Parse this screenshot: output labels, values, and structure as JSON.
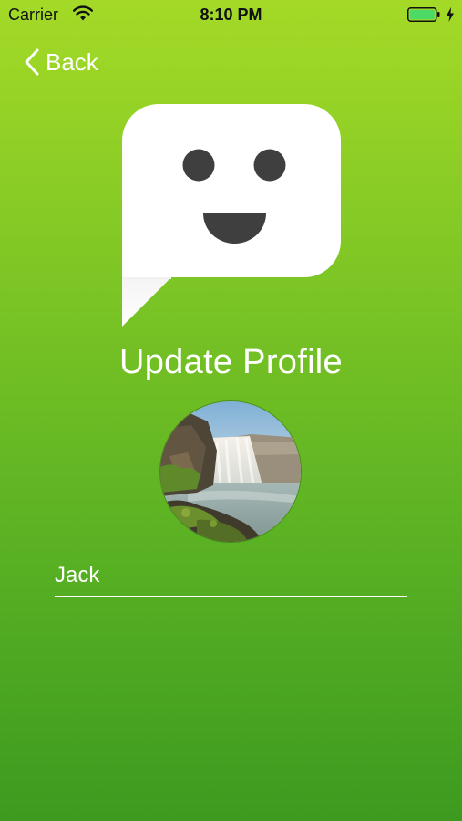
{
  "status_bar": {
    "carrier": "Carrier",
    "time": "8:10 PM",
    "wifi_icon": "wifi-icon",
    "battery_icon": "battery-icon",
    "battery_level": 1.0,
    "charging_icon": "bolt-icon"
  },
  "nav": {
    "back_label": "Back",
    "back_icon": "chevron-left-icon"
  },
  "logo": {
    "icon": "smiley-speech-bubble-icon"
  },
  "title": "Update Profile",
  "avatar": {
    "image": "waterfall-photo"
  },
  "name_field": {
    "value": "Jack"
  },
  "colors": {
    "gradient_top": "#a4da27",
    "gradient_bottom": "#3d9a1f",
    "text": "#ffffff",
    "battery_fill": "#4cd964"
  }
}
